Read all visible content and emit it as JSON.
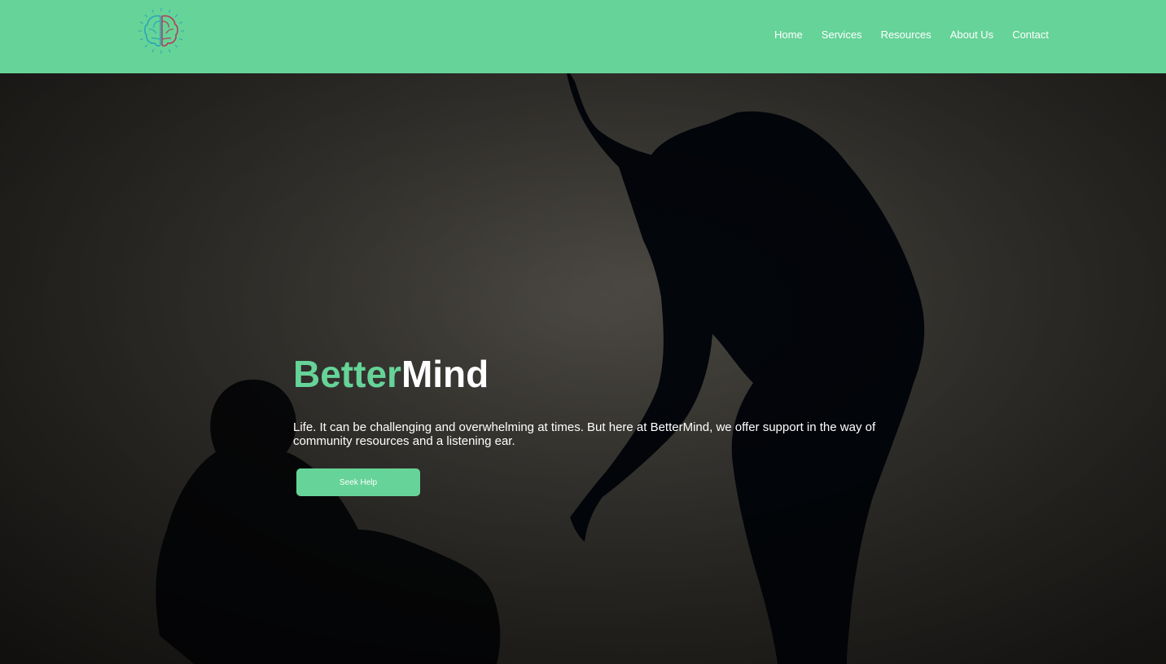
{
  "header": {
    "logo_icon": "brain-icon",
    "nav": [
      {
        "label": "Home"
      },
      {
        "label": "Services"
      },
      {
        "label": "Resources"
      },
      {
        "label": "About Us"
      },
      {
        "label": "Contact"
      }
    ]
  },
  "hero": {
    "title_part1": "Better",
    "title_part2": "Mind",
    "tagline": "Life. It can be challenging and overwhelming at times. But here at BetterMind, we offer support in the way of community resources and a listening ear.",
    "cta_label": "Seek Help"
  },
  "colors": {
    "accent": "#66d398",
    "text_light": "#ffffff",
    "background": "#2a2824"
  }
}
